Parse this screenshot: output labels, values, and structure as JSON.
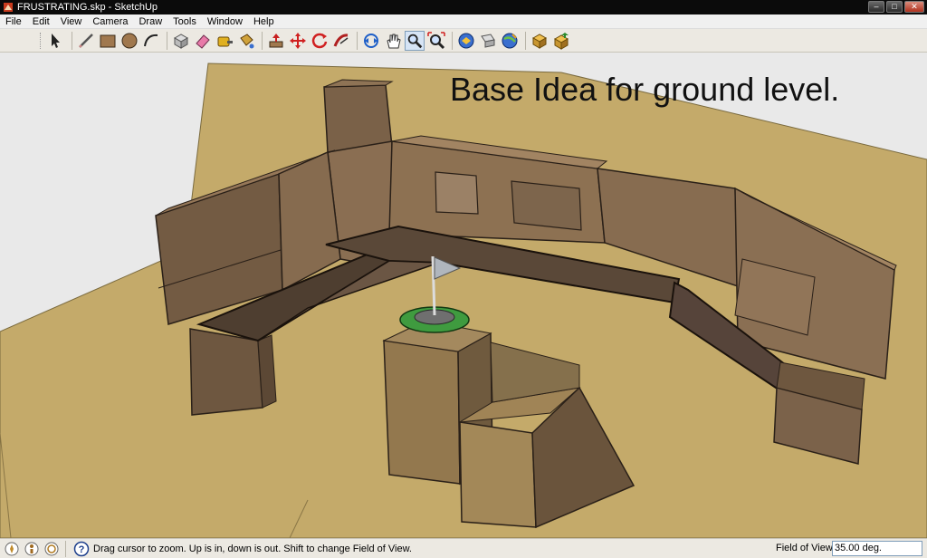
{
  "window": {
    "title": "FRUSTRATING.skp - SketchUp"
  },
  "menu": [
    "File",
    "Edit",
    "View",
    "Camera",
    "Draw",
    "Tools",
    "Window",
    "Help"
  ],
  "toolbar": [
    {
      "name": "select-tool-icon"
    },
    {
      "sep": true
    },
    {
      "name": "pencil-line-tool-icon"
    },
    {
      "name": "rectangle-tool-icon"
    },
    {
      "name": "circle-tool-icon"
    },
    {
      "name": "arc-tool-icon"
    },
    {
      "sep": true
    },
    {
      "name": "make-component-icon"
    },
    {
      "name": "eraser-tool-icon"
    },
    {
      "name": "tape-measure-icon"
    },
    {
      "name": "paint-bucket-icon"
    },
    {
      "sep": true
    },
    {
      "name": "push-pull-icon"
    },
    {
      "name": "move-tool-icon"
    },
    {
      "name": "rotate-tool-icon"
    },
    {
      "name": "follow-me-icon"
    },
    {
      "sep": true
    },
    {
      "name": "orbit-tool-icon"
    },
    {
      "name": "pan-tool-icon"
    },
    {
      "name": "zoom-tool-icon",
      "active": true
    },
    {
      "name": "zoom-extents-icon"
    },
    {
      "sep": true
    },
    {
      "name": "3d-warehouse-icon"
    },
    {
      "name": "share-model-icon"
    },
    {
      "name": "google-earth-icon"
    },
    {
      "sep": true
    },
    {
      "name": "get-components-icon"
    },
    {
      "name": "share-component-icon"
    }
  ],
  "viewport": {
    "caption": "Base Idea for ground level."
  },
  "status": {
    "icons": [
      "geo-location-icon",
      "credits-icon",
      "user-icon"
    ],
    "help_icon": "help-icon",
    "message": "Drag cursor to zoom.  Up is in, down is out. Shift to change Field of View.",
    "vcb_label": "Field of View",
    "vcb_value": "35.00 deg."
  },
  "colors": {
    "ground": "#c4aa6a",
    "wall_dark": "#5e4c3c",
    "wall_mid": "#796148",
    "wall_light": "#9a7b5a",
    "flag_base": "#3f9b3f",
    "background": "#e9e9e9"
  }
}
